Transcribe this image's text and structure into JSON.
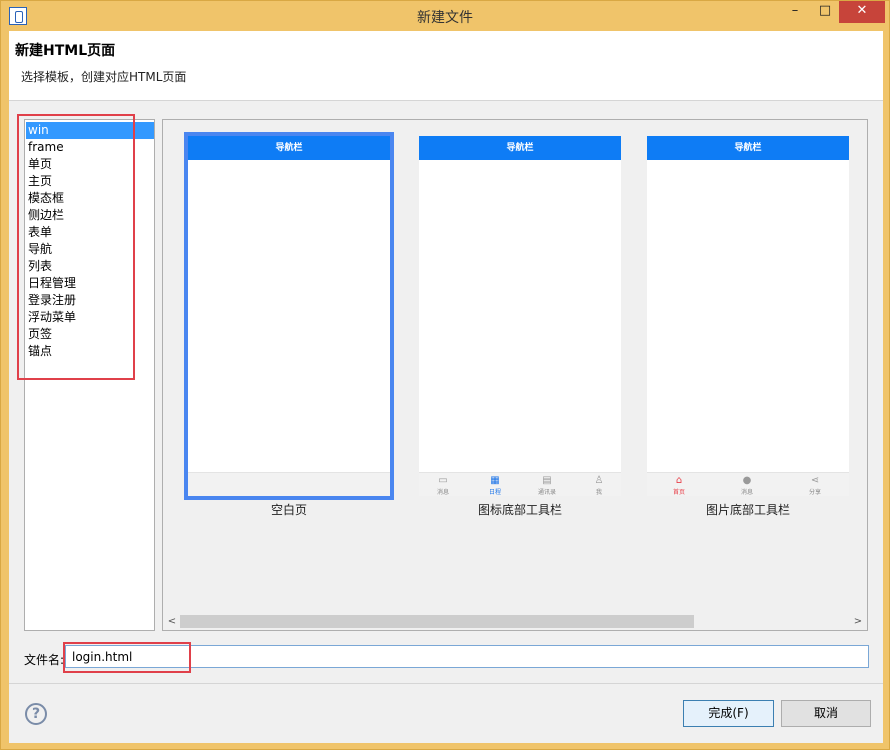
{
  "window": {
    "title": "新建文件",
    "minimize_glyph": "–",
    "maximize_glyph": "□",
    "close_glyph": "✕"
  },
  "header": {
    "title": "新建HTML页面",
    "description": "选择模板，创建对应HTML页面"
  },
  "templates": {
    "items": [
      "win",
      "frame",
      "单页",
      "主页",
      "模态框",
      "侧边栏",
      "表单",
      "导航",
      "列表",
      "日程管理",
      "登录注册",
      "浮动菜单",
      "页签",
      "锚点"
    ],
    "selected": "win"
  },
  "previews": [
    {
      "nav_label": "导航栏",
      "caption": "空白页",
      "selected": true,
      "tabs": []
    },
    {
      "nav_label": "导航栏",
      "caption": "图标底部工具栏",
      "selected": false,
      "tabs": [
        {
          "icon": "chat-icon",
          "glyph": "▭",
          "label": "消息",
          "state": ""
        },
        {
          "icon": "calendar-icon",
          "glyph": "▦",
          "label": "日程",
          "state": "active"
        },
        {
          "icon": "contacts-icon",
          "glyph": "▤",
          "label": "通讯录",
          "state": ""
        },
        {
          "icon": "user-icon",
          "glyph": "♙",
          "label": "我",
          "state": ""
        }
      ]
    },
    {
      "nav_label": "导航栏",
      "caption": "图片底部工具栏",
      "selected": false,
      "tabs": [
        {
          "icon": "home-icon",
          "glyph": "⌂",
          "label": "首页",
          "state": "red"
        },
        {
          "icon": "message-icon",
          "glyph": "●",
          "label": "消息",
          "state": ""
        },
        {
          "icon": "share-icon",
          "glyph": "⋖",
          "label": "分享",
          "state": ""
        }
      ]
    }
  ],
  "scrollbar": {
    "left_arrow": "<",
    "right_arrow": ">"
  },
  "filename": {
    "label": "文件名:",
    "value": "login.html"
  },
  "footer": {
    "help_glyph": "?",
    "finish_label": "完成(F)",
    "cancel_label": "取消"
  },
  "colors": {
    "nav_blue": "#0e7cf5",
    "selection_blue": "#3399ff",
    "highlight_red": "#e0404a",
    "titlebar": "#f0c46a"
  }
}
